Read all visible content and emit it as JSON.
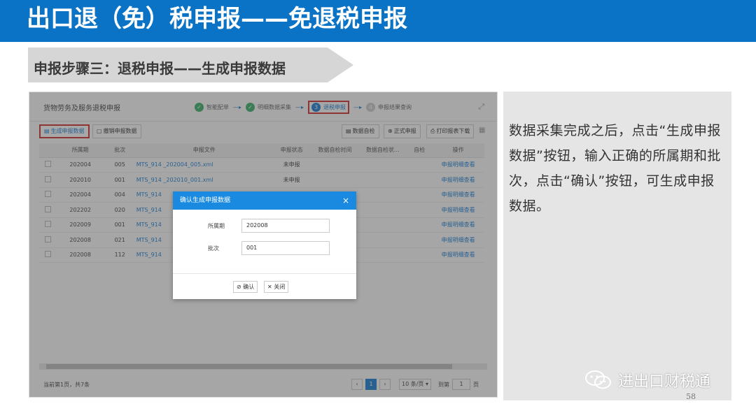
{
  "slide": {
    "title": "出口退（免）税申报——免退税申报",
    "step": "申报步骤三：退税申报——生成申报数据",
    "page_number": "58"
  },
  "app": {
    "module_title": "货物劳务及服务退税申报",
    "steps": [
      "智能配单",
      "明细数据采集",
      "退税申报",
      "申报结果查询"
    ],
    "toolbar": {
      "generate": "生成申报数据",
      "revoke": "撤销申报数据",
      "self_check": "数据自检",
      "formal": "正式申报",
      "print": "打印报表下载"
    },
    "columns": [
      "所属期",
      "批次",
      "申报文件",
      "申报状态",
      "数据自检时间",
      "数据自检状...",
      "自检",
      "操作"
    ],
    "rows": [
      {
        "period": "202004",
        "batch": "005",
        "file": "MTS_914               _202004_005.xml",
        "status": "未申报",
        "op": "申报明细查看"
      },
      {
        "period": "202010",
        "batch": "001",
        "file": "MTS_914               _202010_001.xml",
        "status": "未申报",
        "op": "申报明细查看"
      },
      {
        "period": "202004",
        "batch": "004",
        "file": "MTS_914",
        "status": "",
        "op": "申报明细查看"
      },
      {
        "period": "202202",
        "batch": "020",
        "file": "MTS_914",
        "status": "",
        "op": "申报明细查看"
      },
      {
        "period": "202009",
        "batch": "001",
        "file": "MTS_914",
        "status": "",
        "op": "申报明细查看"
      },
      {
        "period": "202008",
        "batch": "021",
        "file": "MTS_914",
        "status": "",
        "op": "申报明细查看"
      },
      {
        "period": "202008",
        "batch": "112",
        "file": "MTS_914",
        "status": "",
        "op": "申报明细查看"
      }
    ],
    "footer": {
      "info": "当前第1页，共7条",
      "page": "1",
      "page_size": "10 条/页",
      "goto_label": "到第",
      "goto_value": "1",
      "page_unit": "页"
    }
  },
  "dialog": {
    "title": "确认生成申报数据",
    "period_label": "所属期",
    "period_value": "202008",
    "batch_label": "批次",
    "batch_value": "001",
    "confirm": "确认",
    "close": "关闭"
  },
  "instruction": "数据采集完成之后，点击“生成申报数据”按钮，输入正确的所属期和批次，点击“确认”按钮，可生成申报数据。",
  "brand": "进出口财税通",
  "colors": {
    "header_blue": "#0b73c5",
    "highlight_red": "#d32f2f",
    "link_blue": "#1a7fd4"
  }
}
